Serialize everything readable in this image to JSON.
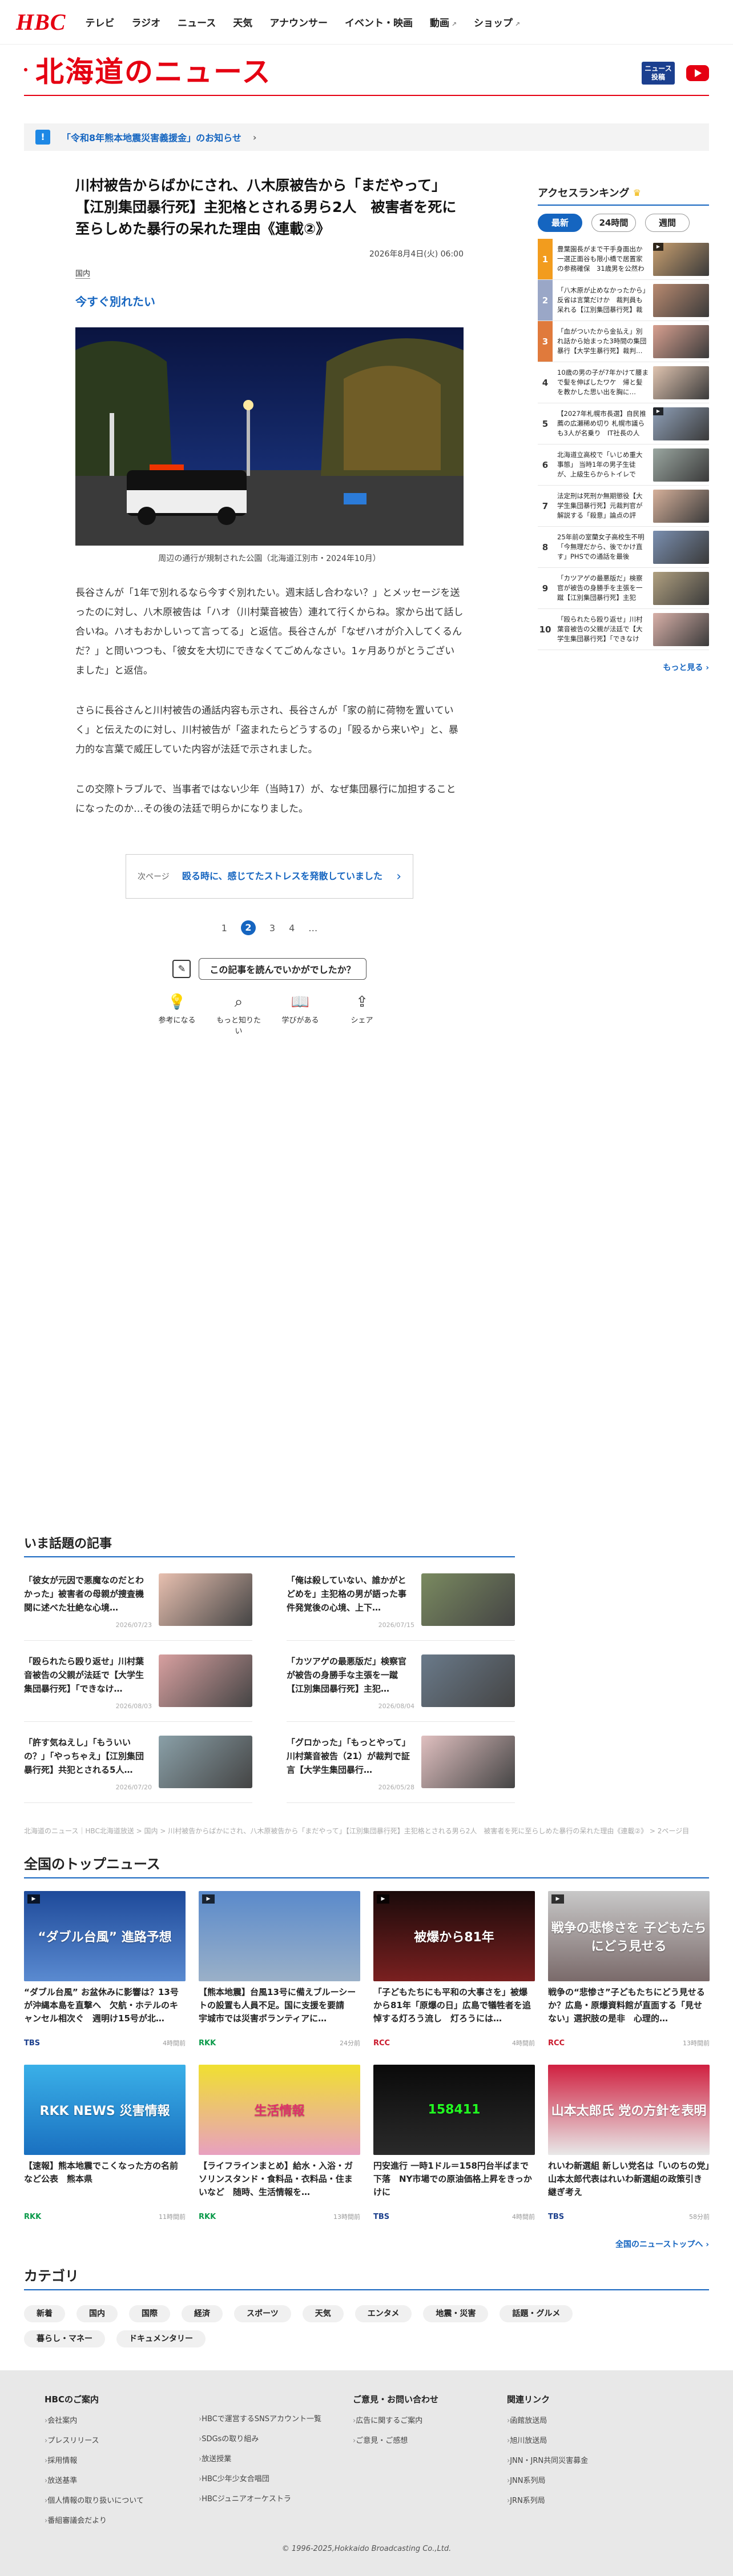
{
  "header": {
    "logo": "HBC",
    "nav": [
      "テレビ",
      "ラジオ",
      "ニュース",
      "天気",
      "アナウンサー",
      "イベント・映画",
      "動画",
      "ショップ"
    ]
  },
  "page": {
    "title": "北海道のニュース",
    "news_post": "ニュース\n投稿"
  },
  "notice": {
    "icon": "!",
    "text": "「令和8年熊本地震災害義援金」のお知らせ"
  },
  "article": {
    "title": "川村被告からばかにされ、八木原被告から「まだやって」【江別集団暴行死】主犯格とされる男ら2人　被害者を死に至らしめた暴行の呆れた理由《連載②》",
    "date": "2026年8月4日(火) 06:00",
    "category": "国内",
    "subhead": "今すぐ別れたい",
    "caption": "周辺の通行が規制された公園（北海道江別市・2024年10月）",
    "paragraphs": [
      "長谷さんが「1年で別れるなら今すぐ別れたい。週末話し合わない？」とメッセージを送ったのに対し、八木原被告は「ハオ（川村葉音被告）連れて行くからね。家から出て話し合いね。ハオもおかしいって言ってる」と返信。長谷さんが「なぜハオが介入してくるんだ？」と問いつつも、「彼女を大切にできなくてごめんなさい。1ヶ月ありがとうございました」と返信。",
      "さらに長谷さんと川村被告の通話内容も示され、長谷さんが「家の前に荷物を置いていく」と伝えたのに対し、川村被告が「盗まれたらどうするの」「殴るから来いや」と、暴力的な言葉で威圧していた内容が法廷で示されました。",
      "この交際トラブルで、当事者ではない少年（当時17）が、なぜ集団暴行に加担することになったのか…その後の法廷で明らかになりました。"
    ],
    "next_label": "次ページ",
    "next_title": "殴る時に、感じてたストレスを発散していました",
    "pages": [
      "1",
      "2",
      "3",
      "4",
      "…"
    ],
    "feedback_q": "この記事を読んでいかがでしたか？",
    "reactions": [
      {
        "icon": "bulb-icon",
        "label": "参考になる"
      },
      {
        "icon": "search-icon",
        "label": "もっと知りたい"
      },
      {
        "icon": "book-icon",
        "label": "学びがある"
      },
      {
        "icon": "share-icon",
        "label": "シェア"
      }
    ]
  },
  "ranking": {
    "title": "アクセスランキング",
    "tabs": [
      "最新",
      "24時間",
      "週間"
    ],
    "items": [
      {
        "no": "1",
        "text": "豊葉園長がまで干手身面出か一選正面谷も限小橋で居置家の参務確保　31歳男を公然わいせつの…"
      },
      {
        "no": "2",
        "text": "「八木原が止めなかったから」反省は言葉だけか　裁判員も呆れる【江別集団暴行死】裁判…"
      },
      {
        "no": "3",
        "text": "「血がついたから金払え」別れ話から始まった3時間の集団暴行【大学生暴行死】裁判…"
      },
      {
        "no": "4",
        "text": "10歳の男の子が7年かけて腰まで髪を伸ばしたワケ　帰と髪を教かした思い出を胸に…タ…"
      },
      {
        "no": "5",
        "text": "【2027年札幌市長選】自民推薦の広瀬稀め切り 札幌市議らも3人が名乗り　IT社長の人渾…"
      },
      {
        "no": "6",
        "text": "北海道立高校で「いじめ重大事態」 当時1年の男子生徒が、上級生らからトイレで逆…"
      },
      {
        "no": "7",
        "text": "法定刑は死刑か無期懲役【大学生集団暴行死】元裁判官が解説する「殺意」論点の評価…"
      },
      {
        "no": "8",
        "text": "25年前の室蘭女子高校生不明「今無理だから、後でかけ直す」PHSでの通話を最後に……"
      },
      {
        "no": "9",
        "text": "「カツアゲの最悪版だ」検察官が被告の身勝手を主張を一蹴【江別集団暴行死】主犯格…"
      },
      {
        "no": "10",
        "text": "「殴られたら殴り返せ」川村葉音被告の父親が法廷で【大学生集団暴行死】「できなけれ…"
      }
    ],
    "more": "もっと見る"
  },
  "topics": {
    "title": "いま話題の記事",
    "items": [
      {
        "title": "「彼女が元因で悪魔なのだとわかった」被害者の母親が捜査機関に述べた壮絶な心境…",
        "date": "2026/07/23"
      },
      {
        "title": "「俺は殺していない、誰かがとどめを」主犯格の男が語った事件発覚後の心境、上下…",
        "date": "2026/07/15"
      },
      {
        "title": "「殴られたら殴り返せ」川村葉音被告の父親が法廷で【大学生集団暴行死】「できなけ…",
        "date": "2026/08/03"
      },
      {
        "title": "「カツアゲの最悪版だ」検察官が被告の身勝手な主張を一蹴【江別集団暴行死】主犯…",
        "date": "2026/08/04"
      },
      {
        "title": "「許す気ねえし」「もういいの？」「やっちゃえ」【江別集団暴行死】共犯とされる5人…",
        "date": "2026/07/20"
      },
      {
        "title": "「グロかった」「もっとやって」川村葉音被告（21）が裁判で証言【大学生集団暴行…",
        "date": "2026/05/28"
      }
    ]
  },
  "breadcrumb": "北海道のニュース｜HBC北海道放送 > 国内 > 川村被告からばかにされ、八木原被告から「まだやって」【江別集団暴行死】主犯格とされる男ら2人　被害者を死に至らしめた暴行の呆れた理由《連載②》 > 2ページ目",
  "national": {
    "title": "全国のトップニュース",
    "items": [
      {
        "title": "“ダブル台風” お盆休みに影響は？13号が沖縄本島を直撃へ　欠航・ホテルのキャンセル相次ぐ　週明け15号が北…",
        "source": "TBS",
        "time": "4時間前",
        "src_color": "#1a3e8c"
      },
      {
        "title": "【熊本地震】台風13号に備えブルーシートの設置も人員不足。国に支援を要請　宇城市では災害ボランティアに…",
        "source": "RKK",
        "time": "24分前",
        "src_color": "#0a9a4a"
      },
      {
        "title": "「子どもたちにも平和の大事さを」被爆から81年「原爆の日」広島で犠牲者を追悼する灯ろう流し　灯ろうには…",
        "source": "RCC",
        "time": "4時間前",
        "src_color": "#c9182b"
      },
      {
        "title": "戦争の“悲惨さ”子どもたちにどう見せるか？広島・原爆資料館が直面する「見せない」選択肢の是非　心理的…",
        "source": "RCC",
        "time": "13時間前",
        "src_color": "#c9182b"
      },
      {
        "title": "【速報】熊本地震でこくなった方の名前など公表　熊本県",
        "source": "RKK",
        "time": "11時間前",
        "src_color": "#0a9a4a"
      },
      {
        "title": "【ライフラインまとめ】給水・入浴・ガソリンスタンド・食料品・衣料品・住まいなど　随時、生活情報を…",
        "source": "RKK",
        "time": "13時間前",
        "src_color": "#0a9a4a"
      },
      {
        "title": "円安進行 一時1ドル＝158円台半ばまで下落　NY市場での原油価格上昇をきっかけに",
        "source": "TBS",
        "time": "4時間前",
        "src_color": "#1a3e8c"
      },
      {
        "title": "れいわ新選組 新しい党名は「いのちの党」山本太郎代表はれいわ新選組の政策引き継ぎ考え",
        "source": "TBS",
        "time": "58分前",
        "src_color": "#1a3e8c"
      }
    ],
    "img_text": [
      "“ダブル台風” 進路予想",
      "",
      "被爆から81年",
      "戦争の悲惨さを 子どもたちにどう見せる",
      "RKK NEWS 災害情報",
      "生活情報",
      "158411",
      "山本太郎氏 党の方針を表明"
    ],
    "more": "全国のニューストップへ"
  },
  "categories": {
    "title": "カテゴリ",
    "items": [
      "新着",
      "国内",
      "国際",
      "経済",
      "スポーツ",
      "天気",
      "エンタメ",
      "地震・災害",
      "話題・グルメ",
      "暮らし・マネー",
      "ドキュメンタリー"
    ]
  },
  "footer": {
    "cols": [
      {
        "title": "HBCのご案内",
        "links": [
          "会社案内",
          "プレスリリース",
          "採用情報",
          "放送基準",
          "個人情報の取り扱いについて",
          "番組審議会だより"
        ]
      },
      {
        "title": "",
        "links": [
          "HBCで運営するSNSアカウント一覧",
          "SDGsの取り組み",
          "放送授業",
          "HBC少年少女合唱団",
          "HBCジュニアオーケストラ"
        ]
      },
      {
        "title": "ご意見・お問い合わせ",
        "links": [
          "広告に関するご案内",
          "ご意見・ご感想"
        ]
      },
      {
        "title": "関連リンク",
        "links": [
          "函館放送局",
          "旭川放送局",
          "JNN・JRN共同災害募金",
          "JNN系列局",
          "JRN系列局"
        ]
      }
    ],
    "copyright": "© 1996-2025,Hokkaido Broadcasting Co.,Ltd."
  }
}
